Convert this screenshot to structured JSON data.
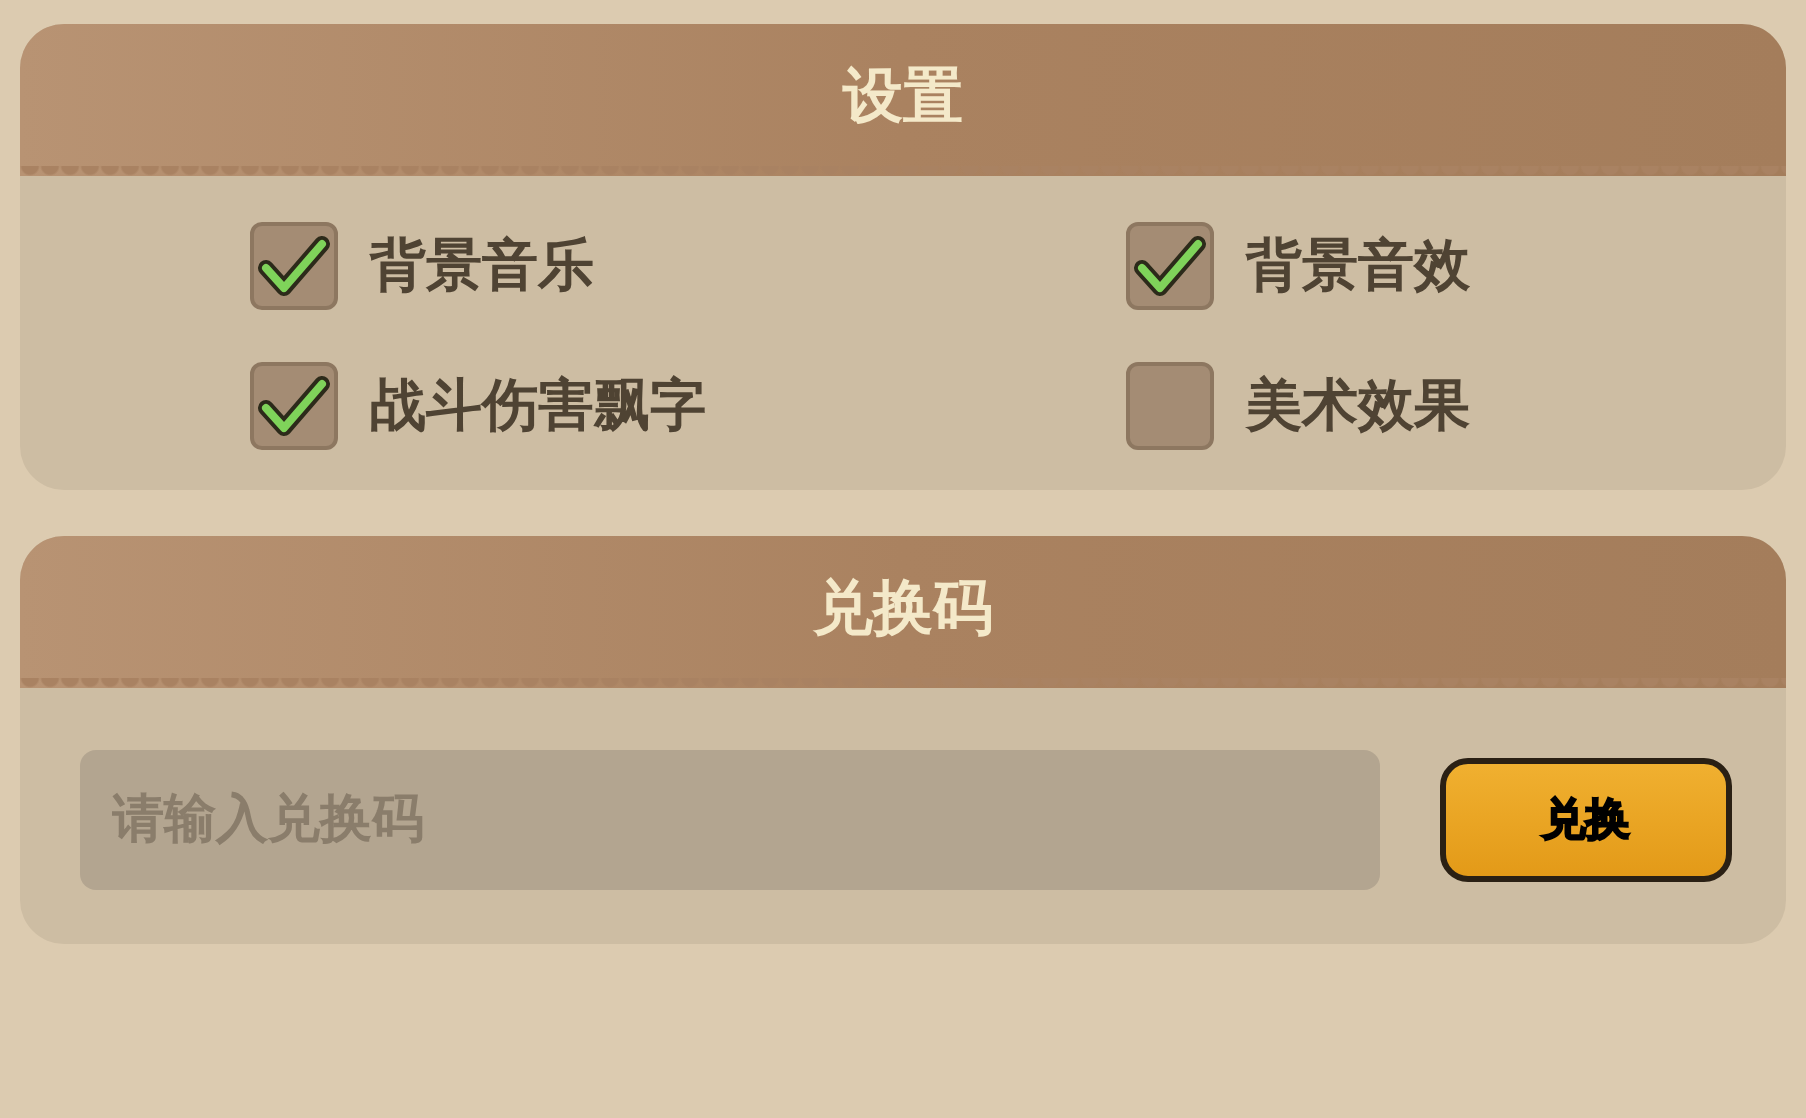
{
  "settings": {
    "title": "设置",
    "options": [
      {
        "label": "背景音乐",
        "checked": true
      },
      {
        "label": "背景音效",
        "checked": true
      },
      {
        "label": "战斗伤害飘字",
        "checked": true
      },
      {
        "label": "美术效果",
        "checked": false
      }
    ]
  },
  "redeem": {
    "title": "兑换码",
    "placeholder": "请输入兑换码",
    "button": "兑换"
  }
}
